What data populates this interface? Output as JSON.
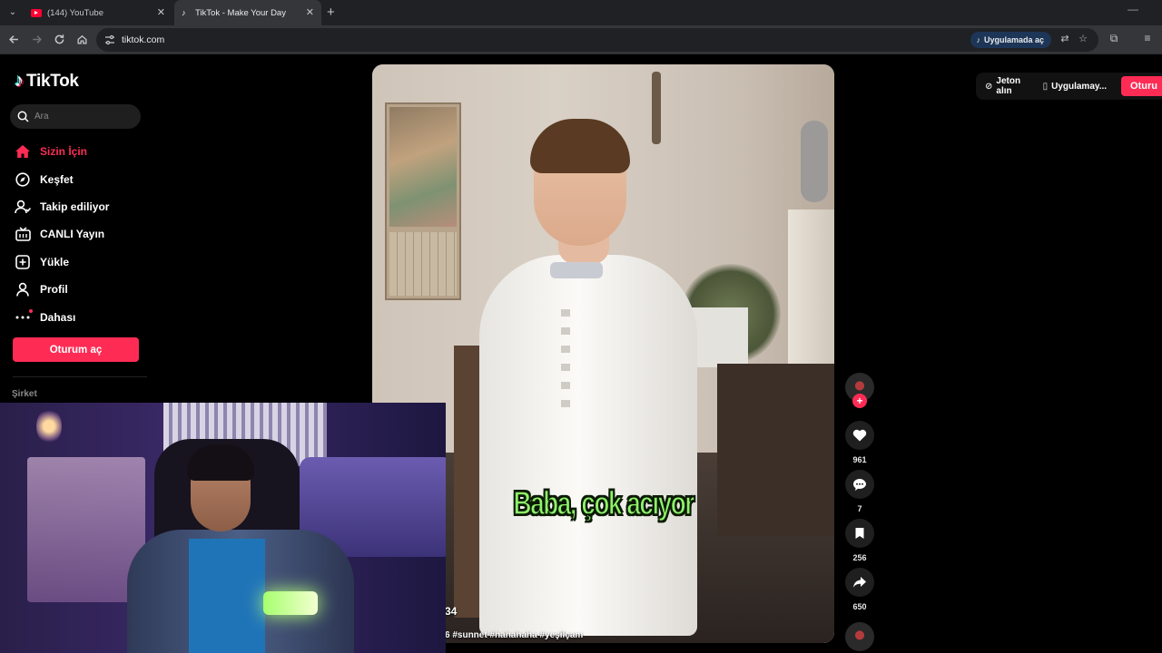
{
  "browser": {
    "tabs": [
      {
        "title": "(144) YouTube",
        "active": false,
        "favicon": "youtube-icon"
      },
      {
        "title": "TikTok - Make Your Day",
        "active": true,
        "favicon": "tiktok-icon"
      }
    ],
    "url": "tiktok.com",
    "open_in_app_label": "Uygulamada aç",
    "icons": [
      "back-icon",
      "forward-icon",
      "reload-icon",
      "home-icon",
      "translate-icon",
      "star-icon",
      "extensions-icon",
      "media-icon"
    ]
  },
  "tiktok": {
    "logo_text": "TikTok",
    "search_placeholder": "Ara",
    "nav": [
      {
        "label": "Sizin İçin",
        "icon": "home-icon",
        "active": true
      },
      {
        "label": "Keşfet",
        "icon": "compass-icon",
        "active": false
      },
      {
        "label": "Takip ediliyor",
        "icon": "following-icon",
        "active": false
      },
      {
        "label": "CANLI Yayın",
        "icon": "live-icon",
        "active": false
      },
      {
        "label": "Yükle",
        "icon": "upload-icon",
        "active": false
      },
      {
        "label": "Profil",
        "icon": "profile-icon",
        "active": false
      },
      {
        "label": "Dahası",
        "icon": "more-icon",
        "active": false
      }
    ],
    "login_button": "Oturum aç",
    "section_company": "Şirket",
    "top_right": {
      "coins_label": "Jeton alın",
      "app_label": "Uygulamay...",
      "login_label": "Oturu"
    },
    "video": {
      "subtitle": "Baba, çok acıyor",
      "author_fragment": "34",
      "caption_fragment": "6 #sunnet #hahahaha #yeşilçam"
    },
    "actions": {
      "likes": "961",
      "comments": "7",
      "saves": "256",
      "shares": "650"
    }
  },
  "colors": {
    "accent": "#fe2c55",
    "background": "#000000",
    "subtitle": "#8ef46a"
  }
}
